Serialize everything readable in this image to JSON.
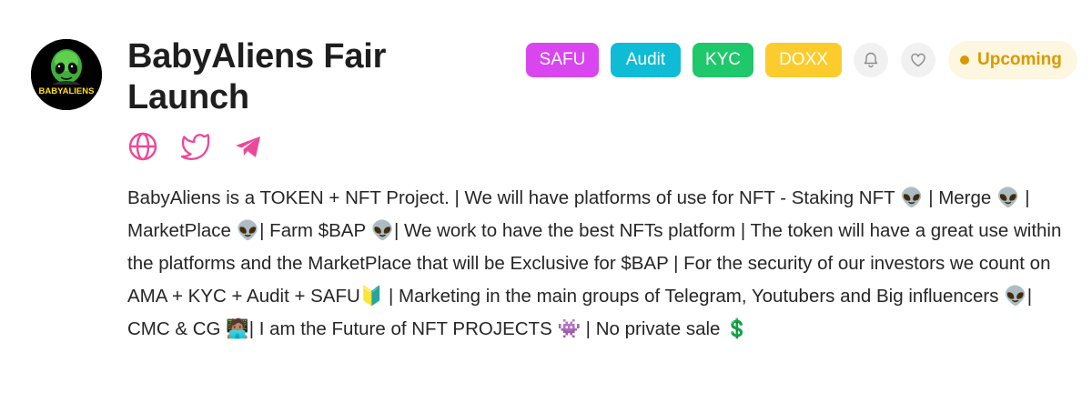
{
  "project": {
    "title": "BabyAliens Fair Launch",
    "logo_text": "BABYALIENS"
  },
  "socials": [
    {
      "icon": "globe-icon"
    },
    {
      "icon": "twitter-icon"
    },
    {
      "icon": "telegram-icon"
    }
  ],
  "badges": {
    "safu": "SAFU",
    "audit": "Audit",
    "kyc": "KYC",
    "doxx": "DOXX"
  },
  "actions": {
    "notify_icon": "bell-icon",
    "favorite_icon": "heart-icon"
  },
  "status": {
    "label": "Upcoming"
  },
  "description": "BabyAliens is a TOKEN + NFT Project. | We will have platforms of use for NFT - Staking NFT 👽 | Merge 👽 | MarketPlace 👽| Farm $BAP 👽| We work to have the best NFTs platform | The token will have a great use within the platforms and the MarketPlace that will be Exclusive for $BAP | For the security of our investors we count on AMA + KYC + Audit + SAFU🔰 | Marketing in the main groups of Telegram, Youtubers and Big influencers 👽| CMC & CG 🧑🏽‍💻| I am the Future of NFT PROJECTS 👾 | No private sale 💲",
  "colors": {
    "accent_pink": "#ec4899",
    "safu": "#d946ef",
    "audit": "#0ebcd6",
    "kyc": "#1fc86a",
    "doxx": "#fbcc2c",
    "status": "#d89a00",
    "status_bg": "#fdf6e0"
  }
}
